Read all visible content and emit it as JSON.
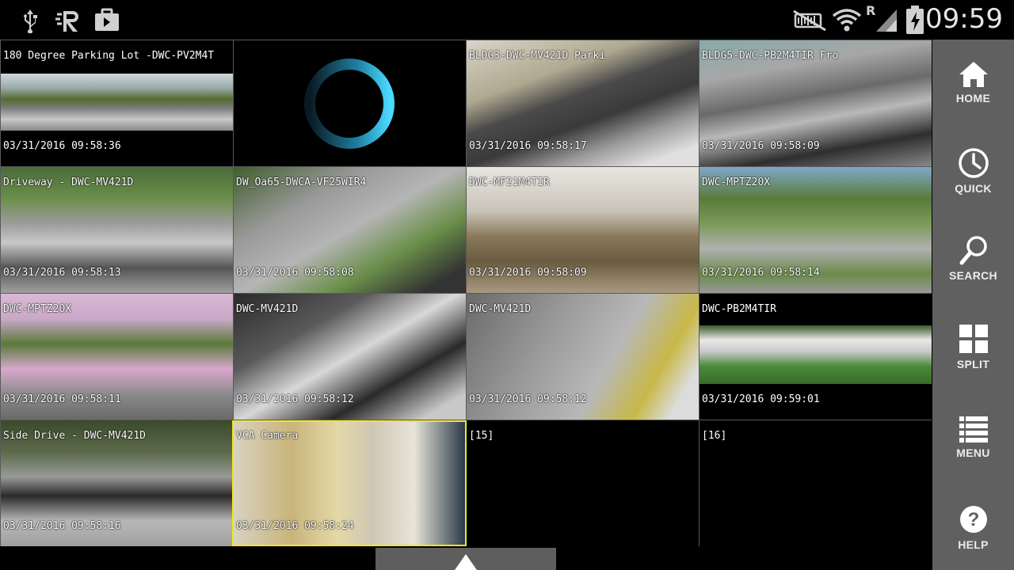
{
  "status_bar": {
    "time": "09:59",
    "roaming": "R",
    "icons": [
      "usb-icon",
      "remote-icon",
      "briefcase-icon",
      "mute-icon",
      "wifi-icon",
      "signal-icon",
      "battery-charging-icon"
    ]
  },
  "cameras": [
    {
      "name": "180 Degree Parking Lot -DWC-PV2M4T",
      "time": "03/31/2016 09:58:36"
    },
    {
      "name": "",
      "time": ""
    },
    {
      "name": "BLDG3-DWC-MV421D Parki",
      "time": "03/31/2016 09:58:17"
    },
    {
      "name": "BLDG5-DWC-PB2M4TIR Fro",
      "time": "03/31/2016 09:58:09"
    },
    {
      "name": "Driveway - DWC-MV421D",
      "time": "03/31/2016 09:58:13"
    },
    {
      "name": "DW_Oa65-DWCA-VF25WIR4",
      "time": "03/31/2016 09:58:08"
    },
    {
      "name": "DWC-MF21M4TIR",
      "time": "03/31/2016 09:58:09"
    },
    {
      "name": "DWC-MPTZ20X",
      "time": "03/31/2016 09:58:14"
    },
    {
      "name": "DWC-MPTZ20X",
      "time": "03/31/2016 09:58:11"
    },
    {
      "name": "DWC-MV421D",
      "time": "03/31/2016 09:58:12"
    },
    {
      "name": "DWC-MV421D",
      "time": "03/31/2016 09:58:12"
    },
    {
      "name": "DWC-PB2M4TIR",
      "time": "03/31/2016 09:59:01"
    },
    {
      "name": "Side Drive - DWC-MV421D",
      "time": "03/31/2016 09:58:16"
    },
    {
      "name": "VCA Camera",
      "time": "03/31/2016 09:58:24"
    },
    {
      "name": "[15]",
      "time": ""
    },
    {
      "name": "[16]",
      "time": ""
    }
  ],
  "side_menu": {
    "home": "HOME",
    "quick": "QUICK",
    "search": "SEARCH",
    "split": "SPLIT",
    "menu": "MENU",
    "help": "HELP"
  },
  "colors": {
    "selected_outline": "#f3e61c",
    "sidebar_bg": "#606060",
    "loading_ring": "#2bc3ea"
  }
}
